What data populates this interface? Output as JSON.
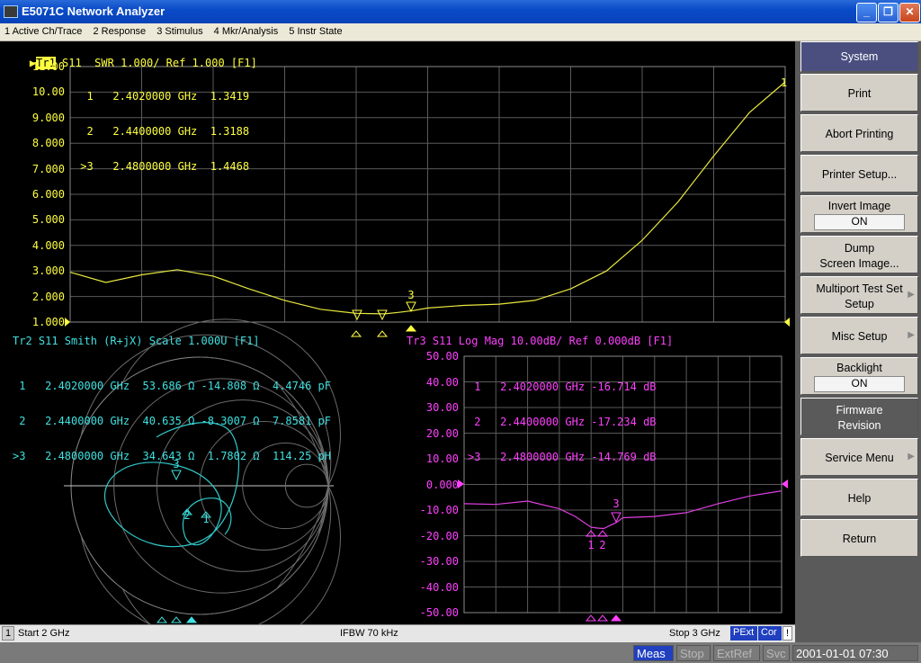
{
  "window": {
    "title": "E5071C Network Analyzer",
    "minimize": "_",
    "restore": "❐",
    "close": "✕"
  },
  "menu": [
    "1 Active Ch/Trace",
    "2 Response",
    "3 Stimulus",
    "4 Mkr/Analysis",
    "5 Instr State"
  ],
  "trace1": {
    "tag": "Tr1",
    "header": " S11  SWR 1.000/ Ref 1.000 [F1]",
    "markers": [
      "  1   2.4020000 GHz  1.3419",
      "  2   2.4400000 GHz  1.3188",
      " >3   2.4800000 GHz  1.4468"
    ],
    "yticks": [
      "11.00",
      "10.00",
      "9.000",
      "8.000",
      "7.000",
      "6.000",
      "5.000",
      "4.000",
      "3.000",
      "2.000",
      "1.000"
    ],
    "end_marker": "1",
    "marker_labels": [
      "1",
      "2",
      "3"
    ],
    "color": "#ffff40"
  },
  "trace2": {
    "header": "Tr2 S11 Smith (R+jX) Scale 1.000U [F1]",
    "markers": [
      " 1   2.4020000 GHz  53.686 Ω -14.808 Ω  4.4746 pF",
      " 2   2.4400000 GHz  40.635 Ω -8.3007 Ω  7.8581 pF",
      ">3   2.4800000 GHz  34.643 Ω  1.7802 Ω  114.25 pH"
    ],
    "marker_labels": [
      "1",
      "2",
      "3"
    ],
    "color": "#40e0e0"
  },
  "trace3": {
    "header": "Tr3 S11 Log Mag 10.00dB/ Ref 0.000dB [F1]",
    "markers": [
      " 1   2.4020000 GHz -16.714 dB",
      " 2   2.4400000 GHz -17.234 dB",
      ">3   2.4800000 GHz -14.769 dB"
    ],
    "yticks": [
      "50.00",
      "40.00",
      "30.00",
      "20.00",
      "10.00",
      "0.000",
      "-10.00",
      "-20.00",
      "-30.00",
      "-40.00",
      "-50.00"
    ],
    "marker_labels": [
      "1",
      "2",
      "3"
    ],
    "color": "#ff40ff"
  },
  "status": {
    "channel": "1",
    "start": "Start 2 GHz",
    "ifbw": "IFBW 70 kHz",
    "stop": "Stop 3 GHz",
    "pext": "PExt",
    "cor": "Cor",
    "bang": "!"
  },
  "bottom": {
    "meas": "Meas",
    "stop": "Stop",
    "extref": "ExtRef",
    "svc": "Svc",
    "datetime": "2001-01-01 07:30"
  },
  "softkeys": [
    {
      "label": "System"
    },
    {
      "label": "Print"
    },
    {
      "label": "Abort Printing"
    },
    {
      "label": "Printer Setup..."
    },
    {
      "label": "Invert Image",
      "value": "ON"
    },
    {
      "label": "Dump",
      "label2": "Screen Image..."
    },
    {
      "label": "Multiport Test Set",
      "label2": "Setup"
    },
    {
      "label": "Misc Setup"
    },
    {
      "label": "Backlight",
      "value": "ON"
    },
    {
      "label": "Firmware",
      "label2": "Revision"
    },
    {
      "label": "Service Menu"
    },
    {
      "label": "Help"
    },
    {
      "label": "Return"
    }
  ],
  "chart_data": [
    {
      "type": "line",
      "x_unit": "GHz",
      "xlim": [
        2,
        3
      ],
      "ylim": [
        1,
        11
      ],
      "series": [
        {
          "name": "S11 SWR",
          "x": [
            2.0,
            2.05,
            2.1,
            2.15,
            2.2,
            2.25,
            2.3,
            2.35,
            2.4,
            2.42,
            2.44,
            2.46,
            2.48,
            2.5,
            2.55,
            2.6,
            2.65,
            2.7,
            2.75,
            2.8,
            2.85,
            2.9,
            2.95,
            3.0
          ],
          "y": [
            2.95,
            2.55,
            2.85,
            3.05,
            2.8,
            2.3,
            1.85,
            1.5,
            1.34,
            1.33,
            1.32,
            1.38,
            1.45,
            1.55,
            1.65,
            1.7,
            1.85,
            2.3,
            3.0,
            4.2,
            5.7,
            7.5,
            9.2,
            10.4
          ]
        }
      ]
    },
    {
      "type": "scatter",
      "series": [
        {
          "name": "S11 Smith",
          "x": [],
          "y": []
        }
      ]
    },
    {
      "type": "line",
      "x_unit": "GHz",
      "xlim": [
        2,
        3
      ],
      "ylim": [
        -50,
        50
      ],
      "series": [
        {
          "name": "S11 Log Mag",
          "x": [
            2.0,
            2.1,
            2.2,
            2.3,
            2.35,
            2.4,
            2.42,
            2.44,
            2.46,
            2.48,
            2.5,
            2.6,
            2.7,
            2.8,
            2.9,
            3.0
          ],
          "y": [
            -7.5,
            -7.8,
            -6.5,
            -9.5,
            -12.5,
            -16.7,
            -17.0,
            -17.2,
            -16.0,
            -14.8,
            -13.0,
            -12.5,
            -11.0,
            -7.5,
            -4.5,
            -2.5
          ]
        }
      ]
    }
  ]
}
